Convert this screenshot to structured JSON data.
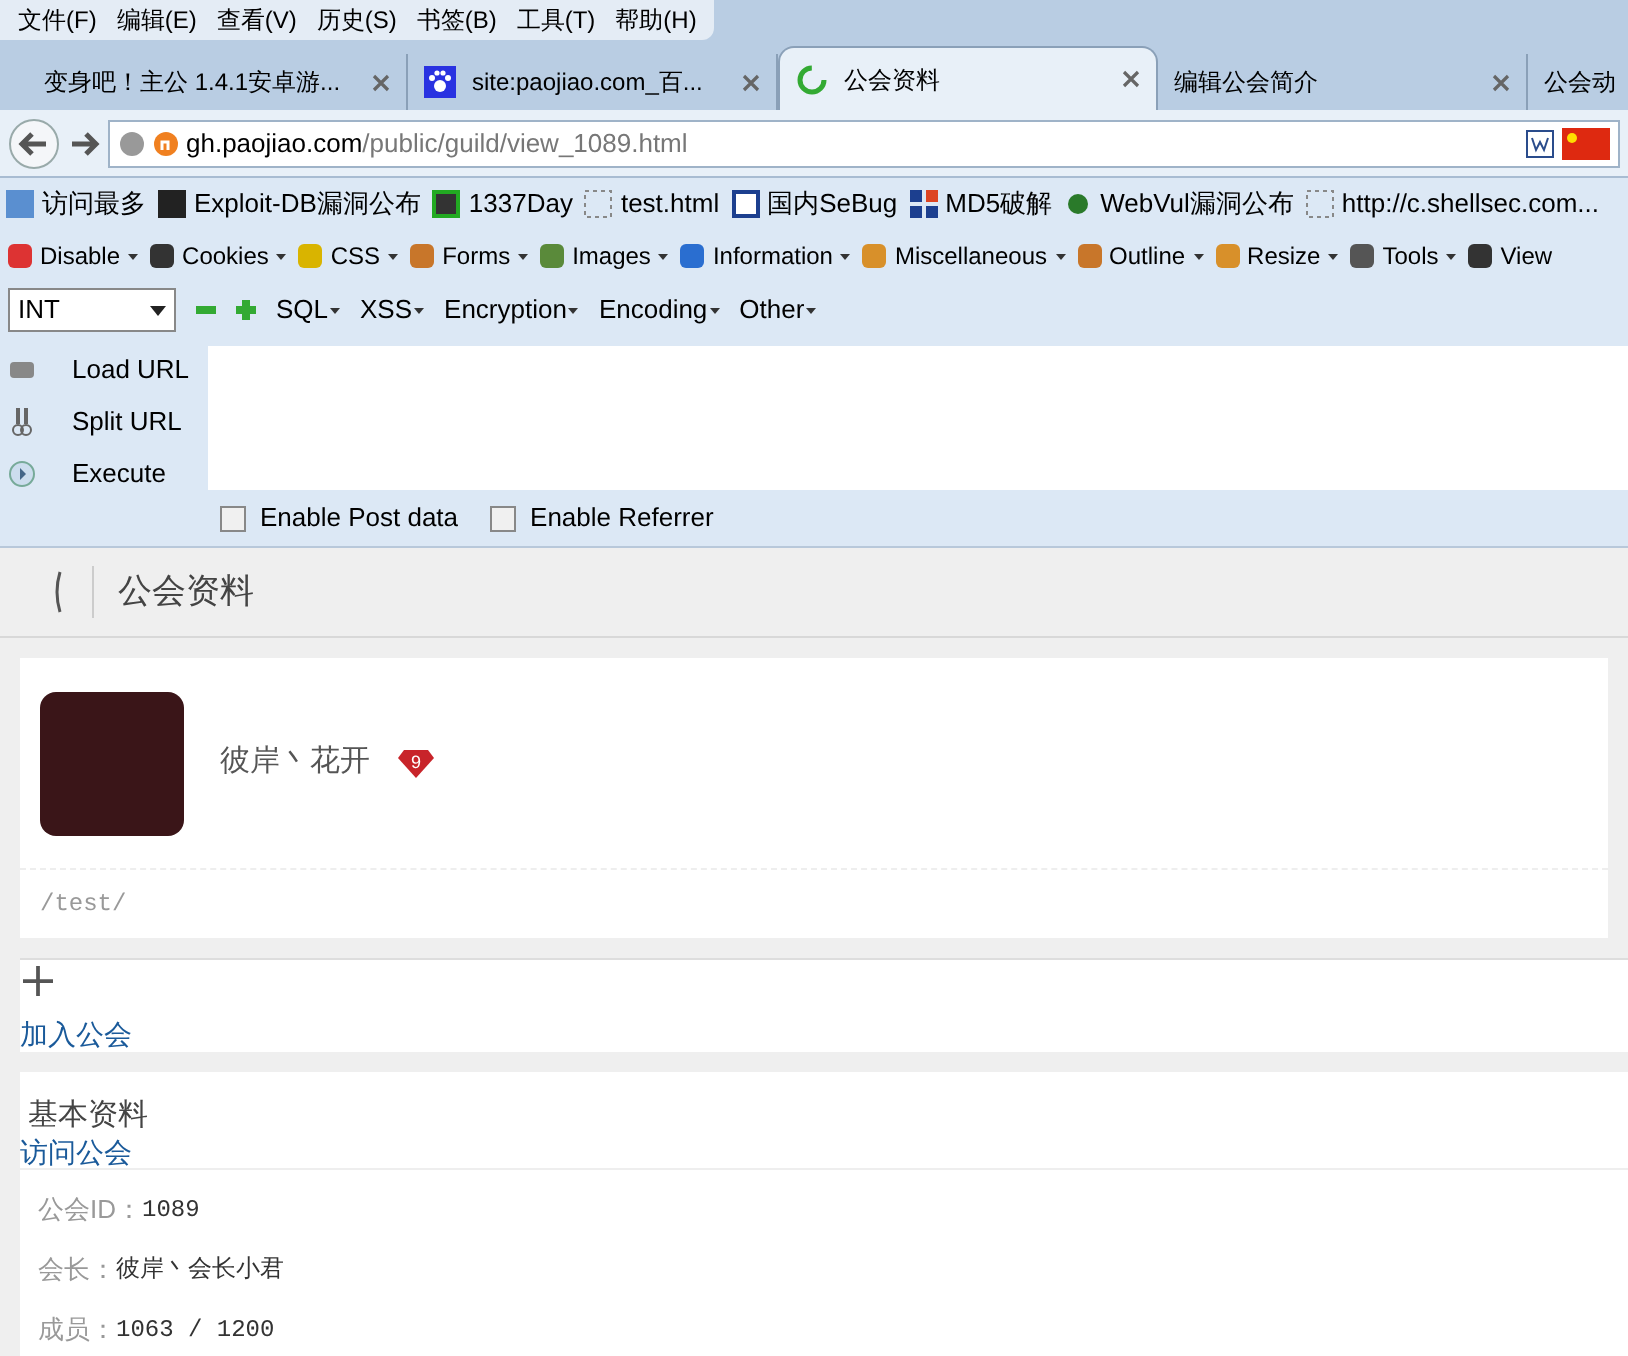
{
  "menu_bar": [
    "文件(F)",
    "编辑(E)",
    "查看(V)",
    "历史(S)",
    "书签(B)",
    "工具(T)",
    "帮助(H)"
  ],
  "tabs": [
    {
      "label": "变身吧！主公 1.4.1安卓游...",
      "selected": false,
      "kind": "plain"
    },
    {
      "label": "site:paojiao.com_百...",
      "selected": false,
      "kind": "paw"
    },
    {
      "label": "公会资料",
      "selected": true,
      "kind": "loading"
    },
    {
      "label": "编辑公会简介",
      "selected": false,
      "kind": "none"
    },
    {
      "label": "公会动",
      "selected": false,
      "kind": "none"
    }
  ],
  "address_bar": {
    "domain": "gh.paojiao.com",
    "path": "/public/guild/view_1089.html"
  },
  "bookmarks": [
    "访问最多",
    "Exploit-DB漏洞公布",
    "1337Day",
    "test.html",
    "国内SeBug",
    "MD5破解",
    "WebVul漏洞公布",
    "http://c.shellsec.com..."
  ],
  "webdev_toolbar": [
    "Disable",
    "Cookies",
    "CSS",
    "Forms",
    "Images",
    "Information",
    "Miscellaneous",
    "Outline",
    "Resize",
    "Tools",
    "View"
  ],
  "hackbar": {
    "select": "INT",
    "menus": [
      "SQL",
      "XSS",
      "Encryption",
      "Encoding",
      "Other"
    ],
    "actions": [
      "Load URL",
      "Split URL",
      "Execute"
    ],
    "options": [
      {
        "label": "Enable Post data",
        "checked": false
      },
      {
        "label": "Enable Referrer",
        "checked": false
      }
    ]
  },
  "page": {
    "header": "公会资料",
    "guild_name": "彼岸丶花开",
    "level": "9",
    "description": "/test/",
    "join_link": "加入公会",
    "section_title": "基本资料",
    "visit_link": "访问公会",
    "info": [
      {
        "label": "公会ID：",
        "value": "1089"
      },
      {
        "label": "会长：",
        "value": "彼岸丶会长小君"
      },
      {
        "label": "成员：",
        "value": "1063 / 1200"
      }
    ]
  }
}
